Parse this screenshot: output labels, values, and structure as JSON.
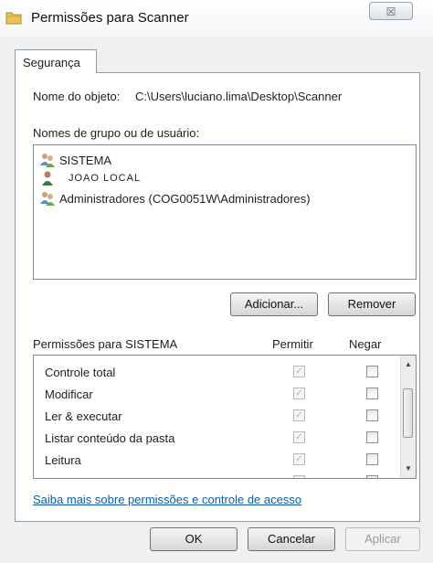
{
  "window": {
    "title": "Permissões para Scanner",
    "close_glyph": "☒"
  },
  "tabs": [
    {
      "label": "Segurança"
    }
  ],
  "object": {
    "label": "Nome do objeto:",
    "value": "C:\\Users\\luciano.lima\\Desktop\\Scanner"
  },
  "users": {
    "label": "Nomes de grupo ou de usuário:",
    "items": [
      {
        "name": "SISTEMA",
        "icon": "users-group-icon"
      },
      {
        "name": "JOAO LOCAL",
        "icon": "user-icon"
      },
      {
        "name": "Administradores (COG0051W\\Administradores)",
        "icon": "users-group-icon"
      }
    ]
  },
  "buttons": {
    "add": "Adicionar...",
    "remove": "Remover"
  },
  "permissions": {
    "label": "Permissões para SISTEMA",
    "allow_header": "Permitir",
    "deny_header": "Negar",
    "rows": [
      {
        "name": "Controle total",
        "allow": true,
        "deny": false
      },
      {
        "name": "Modificar",
        "allow": true,
        "deny": false
      },
      {
        "name": "Ler & executar",
        "allow": true,
        "deny": false
      },
      {
        "name": "Listar conteúdo da pasta",
        "allow": true,
        "deny": false
      },
      {
        "name": "Leitura",
        "allow": true,
        "deny": false
      }
    ]
  },
  "link": "Saiba mais sobre permissões e controle de acesso",
  "dialog_buttons": {
    "ok": "OK",
    "cancel": "Cancelar",
    "apply": "Aplicar"
  }
}
